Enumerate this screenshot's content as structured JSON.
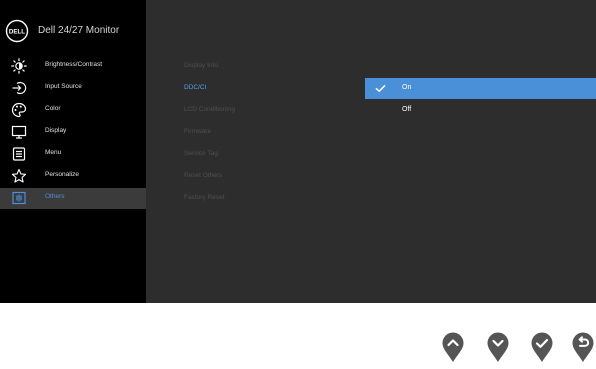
{
  "osd": {
    "title": "Dell 24/27 Monitor",
    "logo_text": "DELL"
  },
  "sidebar": {
    "items": [
      {
        "label": "Brightness/Contrast",
        "icon": "brightness-icon"
      },
      {
        "label": "Input Source",
        "icon": "input-source-icon"
      },
      {
        "label": "Color",
        "icon": "color-icon"
      },
      {
        "label": "Display",
        "icon": "display-icon"
      },
      {
        "label": "Menu",
        "icon": "menu-icon"
      },
      {
        "label": "Personalize",
        "icon": "star-icon"
      },
      {
        "label": "Others",
        "icon": "others-icon",
        "selected": true
      }
    ]
  },
  "others_menu": {
    "items": [
      {
        "label": "Display Info"
      },
      {
        "label": "DDC/CI",
        "active": true
      },
      {
        "label": "LCD Conditioning"
      },
      {
        "label": "Firmware"
      },
      {
        "label": "Service Tag"
      },
      {
        "label": "Reset Others"
      },
      {
        "label": "Factory Reset"
      }
    ]
  },
  "ddcci_options": {
    "items": [
      {
        "label": "On",
        "selected": true
      },
      {
        "label": "Off",
        "selected": false
      }
    ]
  },
  "buttons": [
    {
      "name": "up-button",
      "icon": "chevron-up-icon"
    },
    {
      "name": "down-button",
      "icon": "chevron-down-icon"
    },
    {
      "name": "confirm-button",
      "icon": "check-icon"
    },
    {
      "name": "back-button",
      "icon": "back-arrow-icon"
    }
  ],
  "colors": {
    "accent": "#4a90d9",
    "osd_background": "#2d2d2d",
    "sidebar_background": "#000000",
    "selected_row": "#3b3b3b",
    "inactive_text": "#4f4f4f",
    "button_fill": "#555555"
  }
}
